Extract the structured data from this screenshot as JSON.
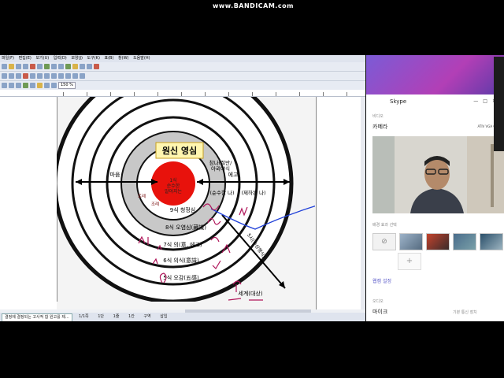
{
  "recorder_banner": "www.BANDICAM.com",
  "hwp": {
    "menu": [
      "파일(F)",
      "편집(E)",
      "보기(U)",
      "입력(D)",
      "모양(J)",
      "도구(K)",
      "표(B)",
      "창(W)",
      "도움말(H)"
    ],
    "zoom": "150 %",
    "status": {
      "doc_tab": "결정에 결정되는 고사적 합 원고를 제...",
      "page": "1/1쪽",
      "section": "1단",
      "line": "1줄",
      "col": "1칸",
      "mode": "구역",
      "insert": "삽입"
    }
  },
  "diagram": {
    "title": "원신 영심",
    "core": "1식\n순수한\n알아지는",
    "left_outer": "마음",
    "right_outer": "에고",
    "ring_right1": "참나(절반/\n아뢰야식",
    "ring_right2": "(순수한 나)",
    "ring_right3": "(제하된 나)",
    "ring9": "9식 청정심",
    "ring8": "8식 오염심(藏識)",
    "ring7": "7식 의(意, 에고)",
    "ring6": "6식 의식(意識)",
    "ring5": "5식 오감(五感)",
    "world": "세계(대상)",
    "arrow_label": "5시(수상행식)",
    "left_small": "토례",
    "left_small2": "조례"
  },
  "skype": {
    "app_title": "Skype",
    "section_video": "비디오",
    "camera_label": "카메라",
    "camera_device": "ATIV VGA Came",
    "bg_effects": "배경 효과 선택",
    "webcam_settings": "웹캠 설정",
    "audio": "오디오",
    "mic_label": "마이크",
    "mic_device": "기본 통신 장치"
  },
  "colors": {
    "accent_red": "#e8120c",
    "ring_gray": "#c8c8c8",
    "annotation_pen": "#b0165a",
    "blue_line": "#2040d8",
    "skype_gradient": "#8a4fd0"
  }
}
